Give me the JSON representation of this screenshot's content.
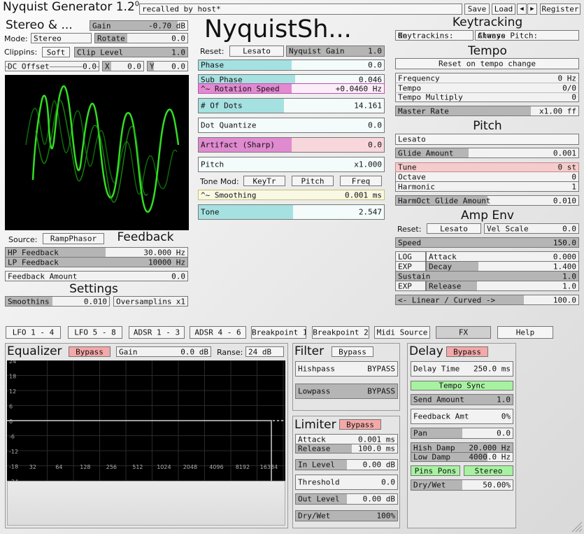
{
  "header": {
    "title": "Nyquist Generator 1.2",
    "version": "0",
    "preset": "recalled by host*",
    "save": "Save",
    "load": "Load",
    "prev": "◀",
    "next": "▶",
    "register": "Register"
  },
  "osc": {
    "title": "Stereo & ...",
    "gain_l": "Gain",
    "gain_v": "-0.70 dB",
    "mode_l": "Mode:",
    "mode_v": "Stereo",
    "rotate_l": "Rotate",
    "rotate_v": "0.0",
    "clip_l": "Clippins:",
    "clip_v": "Soft",
    "cliplevel_l": "Clip Level",
    "cliplevel_v": "1.0",
    "dc_l": "DC Offset",
    "dc_v": "0.0",
    "x_l": "X",
    "x_v": "0.0",
    "y_l": "Y",
    "y_v": "0.0"
  },
  "feedback": {
    "source_l": "Source:",
    "source_v": "RampPhasor",
    "title": "Feedback",
    "hp_l": "HP Feedback",
    "hp_v": "30.000 Hz",
    "lp_l": "LP Feedback",
    "lp_v": "10000 Hz",
    "amt_l": "Feedback Amount",
    "amt_v": "0.0"
  },
  "settings": {
    "title": "Settings",
    "smooth_l": "Smoothins",
    "smooth_v": "0.010",
    "over_l": "Oversamplins",
    "over_v": "x1"
  },
  "center": {
    "name": "NyquistSh...",
    "reset_l": "Reset:",
    "reset_v": "Lesato",
    "ngain_l": "Nyquist Gain",
    "ngain_v": "1.0",
    "phase_l": "Phase",
    "phase_v": "0.0",
    "subphase_l": "Sub Phase",
    "subphase_v": "0.046",
    "rot_l": "^~ Rotation Speed",
    "rot_v": "+0.0460 Hz",
    "dots_l": "# Of Dots",
    "dots_v": "14.161",
    "dq_l": "Dot Quantize",
    "dq_v": "0.0",
    "art_l": "Artifact (Sharp)",
    "art_v": "0.0",
    "pitch_l": "Pitch",
    "pitch_v": "x1.000",
    "tonemod_l": "Tone Mod:",
    "keytr": "KeyTr",
    "pitchb": "Pitch",
    "freq": "Freq",
    "smoothing_l": "^~ Smoothing",
    "smoothing_v": "0.001 ms",
    "tone_l": "Tone",
    "tone_v": "2.547"
  },
  "keytracking": {
    "title": "Keytracking",
    "kt_l": "Keytrackins:",
    "kt_v": "On",
    "cp_l": "Chanse Pitch:",
    "cp_v": "Always"
  },
  "tempo": {
    "title": "Tempo",
    "reset": "Reset on tempo change",
    "freq_l": "Frequency",
    "freq_v": "0 Hz",
    "tempo_l": "Tempo",
    "tempo_v": "0/0",
    "mult_l": "Tempo Multiply",
    "mult_v": "0",
    "master_l": "Master Rate",
    "master_v": "x1.00 ff"
  },
  "pitch": {
    "title": "Pitch",
    "mode": "Lesato",
    "glide_l": "Glide Amount",
    "glide_v": "0.001",
    "tune_l": "Tune",
    "tune_v": "0 st",
    "oct_l": "Octave",
    "oct_v": "0",
    "harm_l": "Harmonic",
    "harm_v": "1",
    "hglide_l": "HarmOct Glide Amount",
    "hglide_v": "0.010"
  },
  "ampenv": {
    "title": "Amp Env",
    "reset_l": "Reset:",
    "reset_v": "Lesato",
    "vel_l": "Vel Scale",
    "vel_v": "0.0",
    "speed_l": "Speed",
    "speed_v": "150.0",
    "log": "LOG",
    "attack_l": "Attack",
    "attack_v": "0.000",
    "exp1": "EXP",
    "decay_l": "Decay",
    "decay_v": "1.400",
    "sustain_l": "Sustain",
    "sustain_v": "1.0",
    "exp2": "EXP",
    "release_l": "Release",
    "release_v": "1.0",
    "curve_l": "<- Linear / Curved ->",
    "curve_v": "100.0"
  },
  "tabs": [
    "LFO 1 - 4",
    "LFO 5 - 8",
    "ADSR 1 - 3",
    "ADSR 4 - 6",
    "Breakpoint 1",
    "Breakpoint 2",
    "Midi Source",
    "FX",
    "Help"
  ],
  "eq": {
    "title": "Equalizer",
    "bypass": "Bypass",
    "gain_l": "Gain",
    "gain_v": "0.0 dB",
    "range_l": "Ranse:",
    "range_v": "24 dB",
    "db": [
      "24",
      "18",
      "12",
      "6",
      "0",
      "-6",
      "-12",
      "-18",
      "-24"
    ],
    "freqs": [
      "32",
      "64",
      "128",
      "256",
      "512",
      "1024",
      "2048",
      "4096",
      "8192",
      "16384"
    ]
  },
  "filter": {
    "title": "Filter",
    "bypass": "Bypass",
    "hp_l": "Hishpass",
    "hp_v": "BYPASS",
    "lp_l": "Lowpass",
    "lp_v": "BYPASS"
  },
  "limiter": {
    "title": "Limiter",
    "bypass": "Bypass",
    "attack_l": "Attack",
    "attack_v": "0.001 ms",
    "release_l": "Release",
    "release_v": "100.0 ms",
    "in_l": "In Level",
    "in_v": "0.00 dB",
    "thr_l": "Threshold",
    "thr_v": "0.0",
    "out_l": "Out Level",
    "out_v": "0.00 dB",
    "dw_l": "Dry/Wet",
    "dw_v": "100%"
  },
  "delay": {
    "title": "Delay",
    "bypass": "Bypass",
    "time_l": "Delay Time",
    "time_v": "250.0 ms",
    "sync": "Tempo Sync",
    "send_l": "Send Amount",
    "send_v": "1.0",
    "fb_l": "Feedback Amt",
    "fb_v": "0%",
    "pan_l": "Pan",
    "pan_v": "0.0",
    "hd_l": "Hish Damp",
    "hd_v": "20.000 Hz",
    "ld_l": "Low Damp",
    "ld_v": "4000.0 Hz",
    "pingpong": "Pins Pons",
    "stereo": "Stereo",
    "dw_l": "Dry/Wet",
    "dw_v": "50.00%"
  },
  "colors": {
    "cyan": "#a6e1e1",
    "magenta": "#e08ad0",
    "pink": "#f4c2cc",
    "yellow": "#f0edb8",
    "green_wave": "#33dd22"
  }
}
